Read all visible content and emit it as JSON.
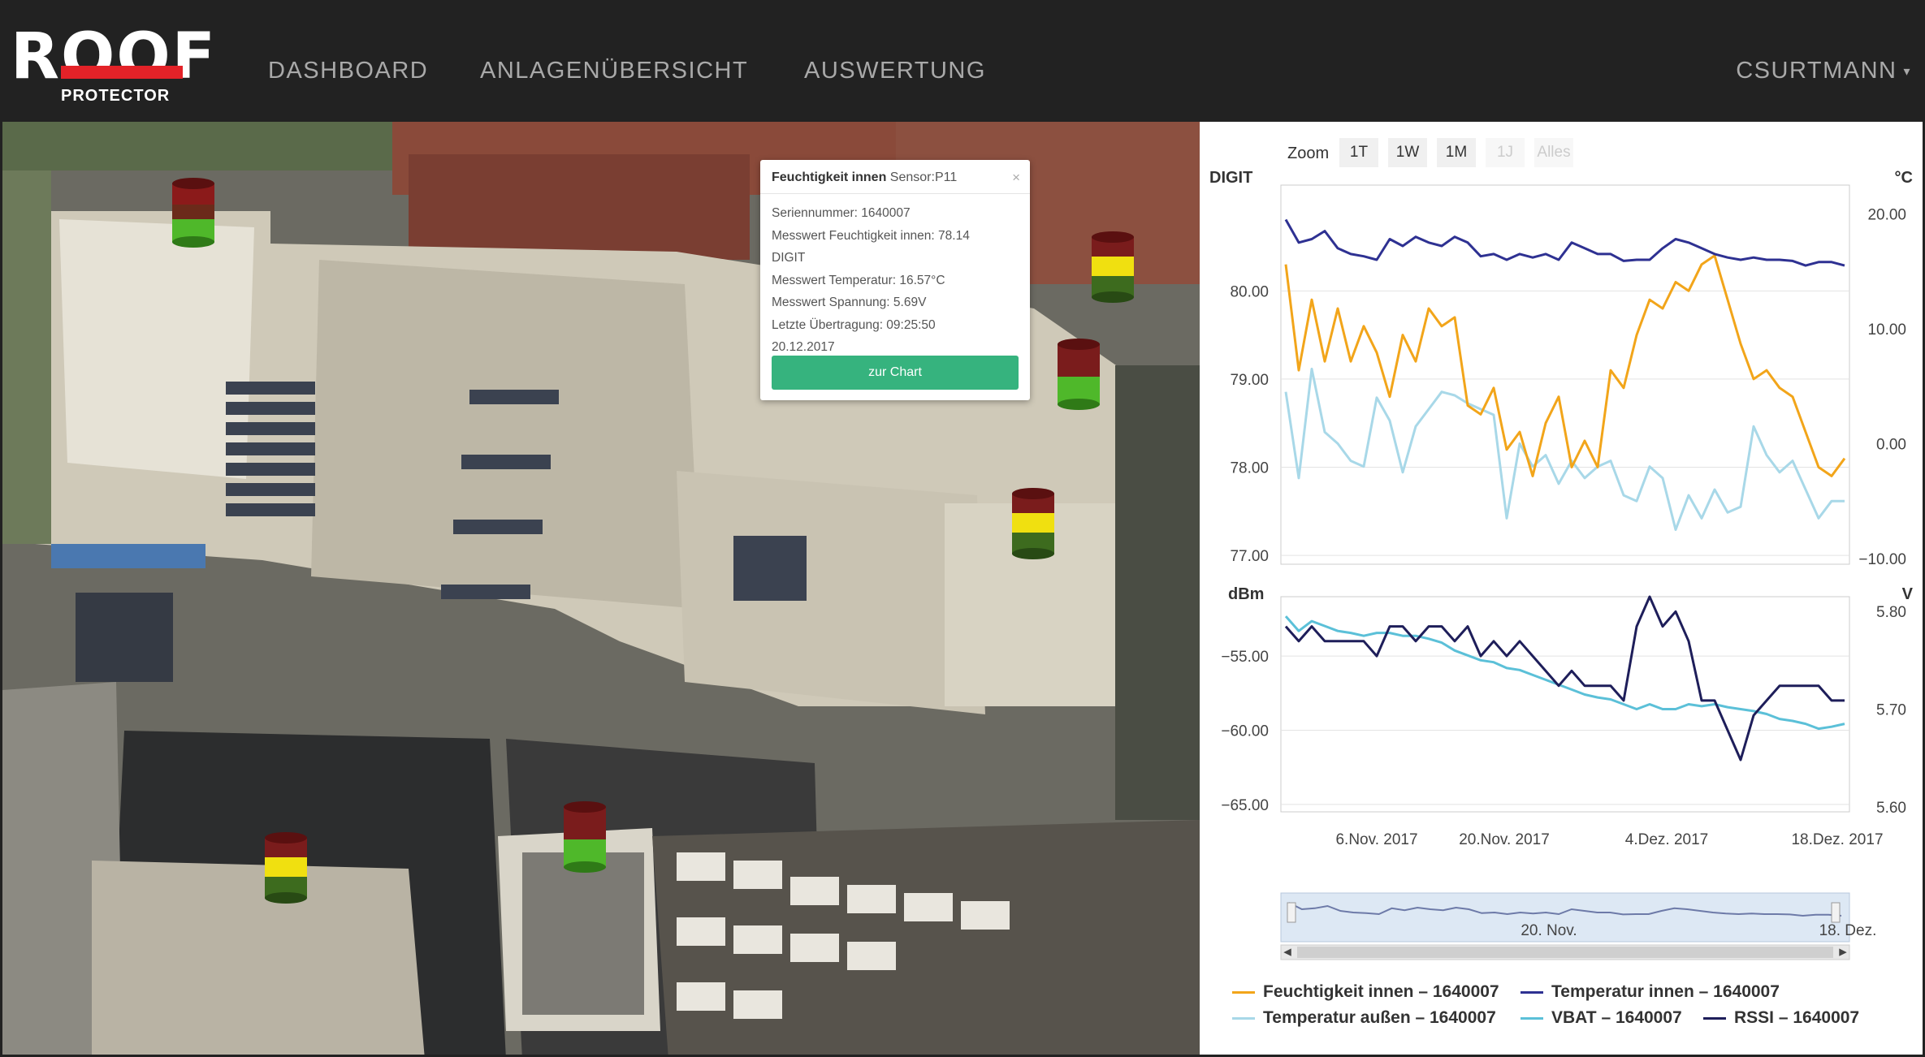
{
  "brand": {
    "word": "ROOF",
    "sub": "PROTECTOR",
    "accent": "#e32228"
  },
  "nav": {
    "items": [
      {
        "label": "DASHBOARD"
      },
      {
        "label": "ANLAGENÜBERSICHT"
      },
      {
        "label": "AUSWERTUNG"
      }
    ],
    "user": "CSURTMANN"
  },
  "map": {
    "sensors": [
      {
        "state": "green-red"
      },
      {
        "state": "yellow"
      },
      {
        "state": "green-red"
      },
      {
        "state": "yellow"
      },
      {
        "state": "green-red"
      },
      {
        "state": "yellow"
      }
    ],
    "colors": {
      "red": "#8b1a1a",
      "yellow": "#f0e010",
      "green": "#4fb82a"
    }
  },
  "popup": {
    "title": "Feuchtigkeit innen",
    "sensor": "Sensor:P11",
    "close": "×",
    "lines": [
      "Seriennummer: 1640007",
      "Messwert Feuchtigkeit innen: 78.14",
      "DIGIT",
      "Messwert Temperatur: 16.57°C",
      "Messwert Spannung: 5.69V",
      "Letzte Übertragung: 09:25:50",
      "20.12.2017"
    ],
    "button": "zur Chart",
    "button_color": "#36b37e"
  },
  "zoom": {
    "label": "Zoom",
    "buttons": [
      {
        "label": "1T",
        "enabled": true
      },
      {
        "label": "1W",
        "enabled": true
      },
      {
        "label": "1M",
        "enabled": true
      },
      {
        "label": "1J",
        "enabled": false
      },
      {
        "label": "Alles",
        "enabled": false
      }
    ]
  },
  "chart_data": [
    {
      "type": "line",
      "title": "",
      "x": [
        "2017-10-29",
        "2017-10-30",
        "2017-10-31",
        "2017-11-01",
        "2017-11-02",
        "2017-11-03",
        "2017-11-04",
        "2017-11-05",
        "2017-11-06",
        "2017-11-07",
        "2017-11-08",
        "2017-11-09",
        "2017-11-10",
        "2017-11-11",
        "2017-11-12",
        "2017-11-13",
        "2017-11-14",
        "2017-11-15",
        "2017-11-16",
        "2017-11-17",
        "2017-11-18",
        "2017-11-19",
        "2017-11-20",
        "2017-11-21",
        "2017-11-22",
        "2017-11-23",
        "2017-11-24",
        "2017-11-25",
        "2017-11-26",
        "2017-11-27",
        "2017-11-28",
        "2017-11-29",
        "2017-11-30",
        "2017-12-01",
        "2017-12-02",
        "2017-12-03",
        "2017-12-04",
        "2017-12-05",
        "2017-12-06",
        "2017-12-07",
        "2017-12-08",
        "2017-12-09",
        "2017-12-10",
        "2017-12-11",
        "2017-12-12",
        "2017-12-13",
        "2017-12-14",
        "2017-12-15",
        "2017-12-16",
        "2017-12-17",
        "2017-12-18",
        "2017-12-19",
        "2017-12-20"
      ],
      "ylabel_left": "DIGIT",
      "ylabel_right": "°C",
      "yticks_left": [
        "80.00",
        "79.00",
        "78.00",
        "77.00"
      ],
      "yticks_right": [
        "20.00",
        "10.00",
        "0.00",
        "−10.00"
      ],
      "ylim_left": [
        76.9,
        81.2
      ],
      "ylim_right": [
        -10.5,
        22.5
      ],
      "grid": true,
      "series": [
        {
          "name": "Feuchtigkeit innen – 1640007",
          "axis": "left",
          "color": "#f2a51a",
          "values": [
            80.3,
            79.1,
            79.9,
            79.2,
            79.8,
            79.2,
            79.6,
            79.3,
            78.8,
            79.5,
            79.2,
            79.8,
            79.6,
            79.7,
            78.7,
            78.6,
            78.9,
            78.2,
            78.4,
            77.9,
            78.5,
            78.8,
            78.0,
            78.3,
            78.0,
            79.1,
            78.9,
            79.5,
            79.9,
            79.8,
            80.1,
            80.0,
            80.3,
            80.4,
            79.9,
            79.4,
            79.0,
            79.1,
            78.9,
            78.8,
            78.4,
            78.0,
            77.9,
            78.1
          ]
        },
        {
          "name": "Temperatur innen – 1640007",
          "axis": "right",
          "color": "#2e3192",
          "values": [
            19.5,
            17.5,
            17.8,
            18.5,
            17.0,
            16.5,
            16.3,
            16.0,
            17.8,
            17.2,
            18.0,
            17.5,
            17.2,
            18.0,
            17.5,
            16.3,
            16.5,
            16.0,
            16.5,
            16.2,
            16.5,
            16.0,
            17.5,
            17.0,
            16.5,
            16.5,
            15.9,
            16.0,
            16.0,
            17.0,
            17.8,
            17.5,
            17.0,
            16.5,
            16.2,
            16.0,
            16.2,
            16.0,
            16.0,
            15.9,
            15.5,
            15.8,
            15.8,
            15.5
          ]
        },
        {
          "name": "Temperatur außen – 1640007",
          "axis": "right",
          "color": "#a8d8e8",
          "values": [
            4.5,
            -3.0,
            6.5,
            1.0,
            0.0,
            -1.5,
            -2.0,
            4.0,
            2.0,
            -2.5,
            1.5,
            3.0,
            4.5,
            4.2,
            3.5,
            3.0,
            2.5,
            -6.5,
            0.0,
            -2.0,
            -1.0,
            -3.5,
            -1.5,
            -3.0,
            -2.0,
            -1.5,
            -4.5,
            -5.0,
            -2.0,
            -3.0,
            -7.5,
            -4.5,
            -6.5,
            -4.0,
            -6.0,
            -5.5,
            1.5,
            -1.0,
            -2.5,
            -1.5,
            -4.0,
            -6.5,
            -5.0,
            -5.0
          ]
        }
      ]
    },
    {
      "type": "line",
      "title": "",
      "ylabel_left": "dBm",
      "ylabel_right": "V",
      "yticks_left": [
        "−55.00",
        "−60.00",
        "−65.00"
      ],
      "yticks_right": [
        "5.80",
        "5.70",
        "5.60"
      ],
      "ylim_left": [
        -65.5,
        -51.0
      ],
      "ylim_right": [
        5.595,
        5.815
      ],
      "xticks": [
        "6.Nov. 2017",
        "20.Nov. 2017",
        "4.Dez. 2017",
        "18.Dez. 2017"
      ],
      "grid": true,
      "series": [
        {
          "name": "VBAT – 1640007",
          "axis": "right",
          "color": "#5bc0d8",
          "values": [
            5.795,
            5.78,
            5.79,
            5.785,
            5.78,
            5.778,
            5.775,
            5.778,
            5.778,
            5.775,
            5.775,
            5.772,
            5.768,
            5.76,
            5.755,
            5.75,
            5.748,
            5.742,
            5.74,
            5.735,
            5.73,
            5.725,
            5.72,
            5.715,
            5.712,
            5.71,
            5.705,
            5.7,
            5.705,
            5.7,
            5.7,
            5.705,
            5.703,
            5.705,
            5.702,
            5.7,
            5.698,
            5.695,
            5.69,
            5.688,
            5.685,
            5.68,
            5.682,
            5.685
          ]
        },
        {
          "name": "RSSI – 1640007",
          "axis": "left",
          "color": "#1e1e5a",
          "values": [
            -53.0,
            -54.0,
            -53.0,
            -54.0,
            -54.0,
            -54.0,
            -54.0,
            -55.0,
            -53.0,
            -53.0,
            -54.0,
            -53.0,
            -53.0,
            -54.0,
            -53.0,
            -55.0,
            -54.0,
            -55.0,
            -54.0,
            -55.0,
            -56.0,
            -57.0,
            -56.0,
            -57.0,
            -57.0,
            -57.0,
            -58.0,
            -53.0,
            -51.0,
            -53.0,
            -52.0,
            -54.0,
            -58.0,
            -58.0,
            -60.0,
            -62.0,
            -59.0,
            -58.0,
            -57.0,
            -57.0,
            -57.0,
            -57.0,
            -58.0,
            -58.0
          ]
        }
      ]
    }
  ],
  "navigator": {
    "labels": [
      "20. Nov.",
      "18. Dez."
    ]
  },
  "legend": [
    {
      "label": "Feuchtigkeit innen – 1640007",
      "color": "#f2a51a"
    },
    {
      "label": "Temperatur innen – 1640007",
      "color": "#2e3192"
    },
    {
      "label": "Temperatur außen – 1640007",
      "color": "#a8d8e8"
    },
    {
      "label": "VBAT – 1640007",
      "color": "#5bc0d8"
    },
    {
      "label": "RSSI – 1640007",
      "color": "#1e1e5a"
    }
  ]
}
